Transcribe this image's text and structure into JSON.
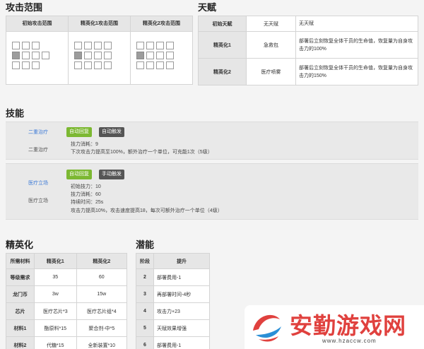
{
  "sections": {
    "range": "攻击范围",
    "talent": "天赋",
    "skill": "技能",
    "elite": "精英化",
    "potential": "潜能"
  },
  "range": {
    "headers": [
      "初始攻击范围",
      "精英化1攻击范围",
      "精英化2攻击范围"
    ]
  },
  "talent": {
    "rows": [
      {
        "stage": "初始天赋",
        "name": "无天赋",
        "desc": "无天赋"
      },
      {
        "stage": "精英化1",
        "name": "急救包",
        "desc": "部署后立刻恢复全体干员的生命值，恢复量为自身攻击力的100%"
      },
      {
        "stage": "精英化2",
        "name": "医疗喷雾",
        "desc": "部署后立刻恢复全体干员的生命值，恢复量为自身攻击力的150%"
      }
    ]
  },
  "skills": [
    {
      "name": "二重治疗",
      "sub": "二重治疗",
      "tag1": "自动回复",
      "tag2": "自动触发",
      "lines": [
        "技力消耗：9",
        "下次攻击力提高至100%，额外治疗一个单位，可充能1次（5级）"
      ]
    },
    {
      "name": "医疗立场",
      "sub": "医疗立场",
      "tag1": "自动回复",
      "tag2": "手动触发",
      "lines": [
        "初始技力：10",
        "技力消耗：60",
        "持续时间：25s",
        "攻击力提高10%，攻击速度提高18，每次可额外治疗一个单位（4级）"
      ]
    }
  ],
  "elite": {
    "headers": [
      "所需材料",
      "精英化1",
      "精英化2"
    ],
    "rows": [
      [
        "等级需求",
        "35",
        "60"
      ],
      [
        "龙门币",
        "3w",
        "15w"
      ],
      [
        "芯片",
        "医疗芯片*3",
        "医疗芯片组*4"
      ],
      [
        "材料1",
        "酯原料*15",
        "聚合剂-中*5"
      ],
      [
        "材料2",
        "代糖*15",
        "全新装置*10"
      ]
    ]
  },
  "potential": {
    "headers": [
      "阶段",
      "提升"
    ],
    "rows": [
      [
        "2",
        "部署费用-1"
      ],
      [
        "3",
        "再部署时间-4秒"
      ],
      [
        "4",
        "攻击力+23"
      ],
      [
        "5",
        "天赋效果增强"
      ],
      [
        "6",
        "部署费用-1"
      ]
    ]
  },
  "watermark": {
    "title": "安勤游戏网",
    "url": "www.hzaccw.com"
  },
  "colors": {
    "green_tag": "#7cb832",
    "gray_tag": "#555555",
    "skill_name": "#3d7ad6",
    "watermark": "#e0413e"
  }
}
